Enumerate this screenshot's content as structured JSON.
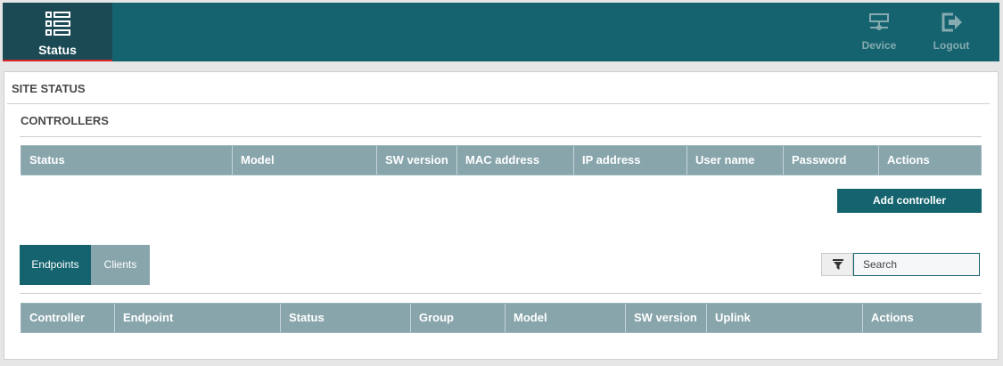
{
  "nav": {
    "status": {
      "label": "Status",
      "icon": "list-icon"
    },
    "device": {
      "label": "Device",
      "icon": "network-device-icon"
    },
    "logout": {
      "label": "Logout",
      "icon": "logout-icon"
    }
  },
  "page": {
    "title": "SITE STATUS",
    "controllers": {
      "title": "CONTROLLERS",
      "columns": [
        "Status",
        "Model",
        "SW version",
        "MAC address",
        "IP address",
        "User name",
        "Password",
        "Actions"
      ],
      "add_button": "Add controller"
    },
    "tabs": [
      "Endpoints",
      "Clients"
    ],
    "active_tab": "Endpoints",
    "search": {
      "placeholder": "Search",
      "filter_icon": "filter-icon"
    },
    "endpoints": {
      "columns": [
        "Controller",
        "Endpoint",
        "Status",
        "Group",
        "Model",
        "SW version",
        "Uplink",
        "Actions"
      ]
    }
  },
  "colors": {
    "header_bg": "#14636e",
    "active_nav_bg": "#1b4a55",
    "active_indicator": "#d9262d",
    "table_header_bg": "#88a5ab"
  }
}
